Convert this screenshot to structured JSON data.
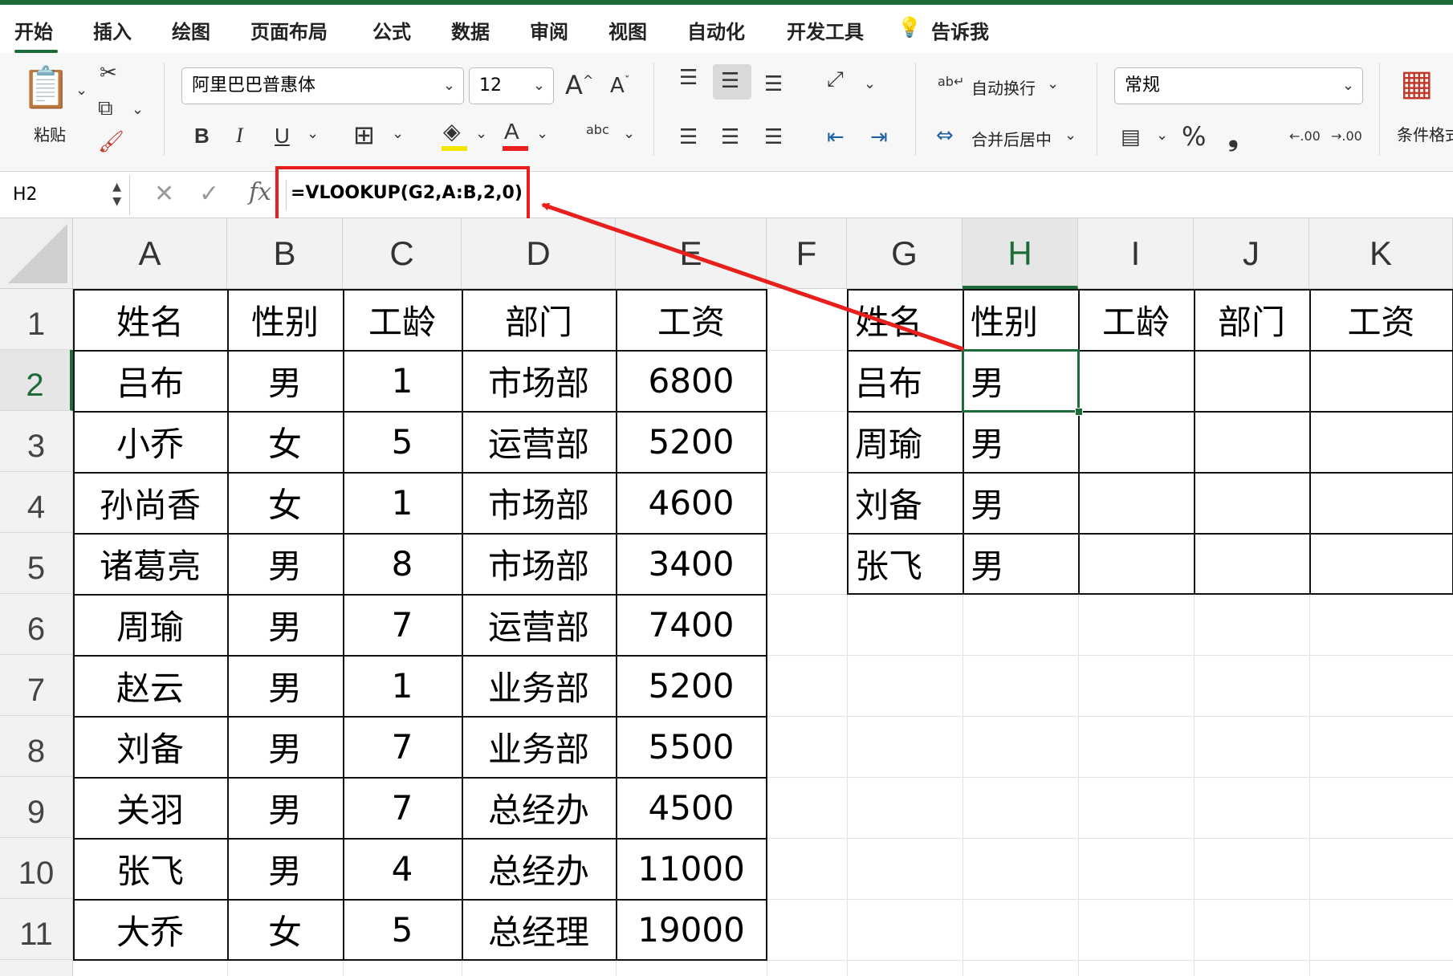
{
  "tabs": [
    "开始",
    "插入",
    "绘图",
    "页面布局",
    "公式",
    "数据",
    "审阅",
    "视图",
    "自动化",
    "开发工具"
  ],
  "tell_me": "告诉我",
  "ribbon": {
    "paste_label": "粘贴",
    "font_name": "阿里巴巴普惠体",
    "font_size": "12",
    "bold": "B",
    "italic": "I",
    "underline": "U",
    "font_color_glyph": "A",
    "grow_font": "A",
    "shrink_font": "A",
    "orientation_glyph": "abc",
    "wrap_text": "自动换行",
    "merge_center": "合并后居中",
    "number_format": "常规",
    "percent": "%",
    "comma": "❟",
    "increase_decimal": ".00",
    "decrease_decimal": ".00",
    "conditional_format": "条件格式"
  },
  "formula_bar": {
    "name_box": "H2",
    "formula": "=VLOOKUP(G2,A:B,2,0)"
  },
  "columns": [
    "A",
    "B",
    "C",
    "D",
    "E",
    "F",
    "G",
    "H",
    "I",
    "J",
    "K"
  ],
  "rows": [
    "1",
    "2",
    "3",
    "4",
    "5",
    "6",
    "7",
    "8",
    "9",
    "10",
    "11"
  ],
  "source_table": {
    "headers": [
      "姓名",
      "性别",
      "工龄",
      "部门",
      "工资"
    ],
    "rows": [
      [
        "吕布",
        "男",
        "1",
        "市场部",
        "6800"
      ],
      [
        "小乔",
        "女",
        "5",
        "运营部",
        "5200"
      ],
      [
        "孙尚香",
        "女",
        "1",
        "市场部",
        "4600"
      ],
      [
        "诸葛亮",
        "男",
        "8",
        "市场部",
        "3400"
      ],
      [
        "周瑜",
        "男",
        "7",
        "运营部",
        "7400"
      ],
      [
        "赵云",
        "男",
        "1",
        "业务部",
        "5200"
      ],
      [
        "刘备",
        "男",
        "7",
        "业务部",
        "5500"
      ],
      [
        "关羽",
        "男",
        "7",
        "总经办",
        "4500"
      ],
      [
        "张飞",
        "男",
        "4",
        "总经办",
        "11000"
      ],
      [
        "大乔",
        "女",
        "5",
        "总经理",
        "19000"
      ]
    ]
  },
  "lookup_table": {
    "headers": [
      "姓名",
      "性别",
      "工龄",
      "部门",
      "工资"
    ],
    "rows": [
      [
        "吕布",
        "男",
        "",
        "",
        ""
      ],
      [
        "周瑜",
        "男",
        "",
        "",
        ""
      ],
      [
        "刘备",
        "男",
        "",
        "",
        ""
      ],
      [
        "张飞",
        "男",
        "",
        "",
        ""
      ]
    ]
  },
  "colors": {
    "accent": "#1e6b3a",
    "highlight": "#e8201c"
  }
}
